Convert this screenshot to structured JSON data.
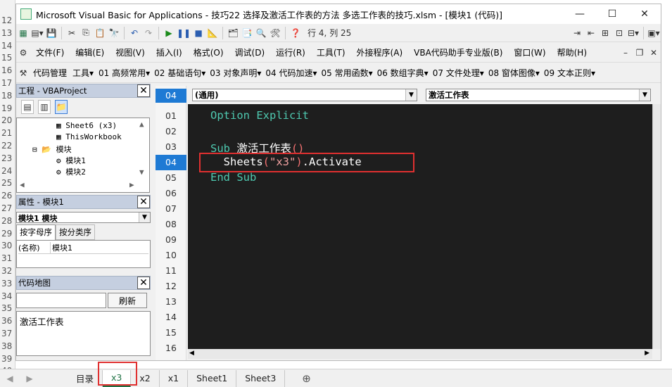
{
  "window": {
    "title": "Microsoft Visual Basic for Applications - 技巧22 选择及激活工作表的方法 多选工作表的技巧.xlsm - [模块1 (代码)]",
    "minimize": "—",
    "maximize": "☐",
    "close": "✕"
  },
  "status": {
    "position": "行 4, 列 25"
  },
  "menu": [
    "文件(F)",
    "编辑(E)",
    "视图(V)",
    "插入(I)",
    "格式(O)",
    "调试(D)",
    "运行(R)",
    "工具(T)",
    "外接程序(A)",
    "VBA代码助手专业版(B)",
    "窗口(W)",
    "帮助(H)"
  ],
  "addin_toolbar": [
    "代码管理",
    "工具▾",
    "01 高频常用▾",
    "02 基础语句▾",
    "03 对象声明▾",
    "04 代码加速▾",
    "05 常用函数▾",
    "06 数组字典▾",
    "07 文件处理▾",
    "08 窗体图像▾",
    "09 文本正则▾"
  ],
  "project": {
    "header": "工程 - VBAProject",
    "nodes": {
      "sheet6": "Sheet6 (x3)",
      "thisworkbook": "ThisWorkbook",
      "modules": "模块",
      "module1": "模块1",
      "module2": "模块2"
    }
  },
  "properties": {
    "header": "属性 - 模块1",
    "object": "模块1 模块",
    "tab_alpha": "按字母序",
    "tab_category": "按分类序",
    "name_key": "(名称)",
    "name_value": "模块1"
  },
  "codemap": {
    "header": "代码地图",
    "refresh": "刷新",
    "item": "激活工作表"
  },
  "code_window": {
    "line_indicator": "04",
    "object_combo": "(通用)",
    "proc_combo": "激活工作表",
    "line_numbers": [
      "01",
      "02",
      "03",
      "04",
      "05",
      "06",
      "07",
      "08",
      "09",
      "10",
      "11",
      "12",
      "13",
      "14",
      "15",
      "16"
    ],
    "selected_line": "04",
    "code": {
      "line1": "Option Explicit",
      "sub_kw": "Sub",
      "sub_name": " 激活工作表",
      "sub_parens": "()",
      "l4_a": "  Sheets",
      "l4_p1": "(",
      "l4_str": "\"x3\"",
      "l4_p2": ")",
      "l4_b": ".Activate",
      "end_sub": "End Sub"
    }
  },
  "excel_rows": [
    "12",
    "13",
    "14",
    "15",
    "16",
    "17",
    "18",
    "19",
    "20",
    "21",
    "22",
    "23",
    "24",
    "25",
    "26",
    "27",
    "28",
    "29",
    "30",
    "31",
    "32",
    "33",
    "34",
    "35",
    "36",
    "37",
    "38",
    "39",
    "40"
  ],
  "sheet_tabs": [
    "目录",
    "x3",
    "x2",
    "x1",
    "Sheet1",
    "Sheet3"
  ],
  "active_sheet": "x3",
  "colors": {
    "accent_red": "#e03030",
    "excel_green": "#217346",
    "editor_bg": "#1e1e1e",
    "keyword": "#4ec9b0"
  }
}
